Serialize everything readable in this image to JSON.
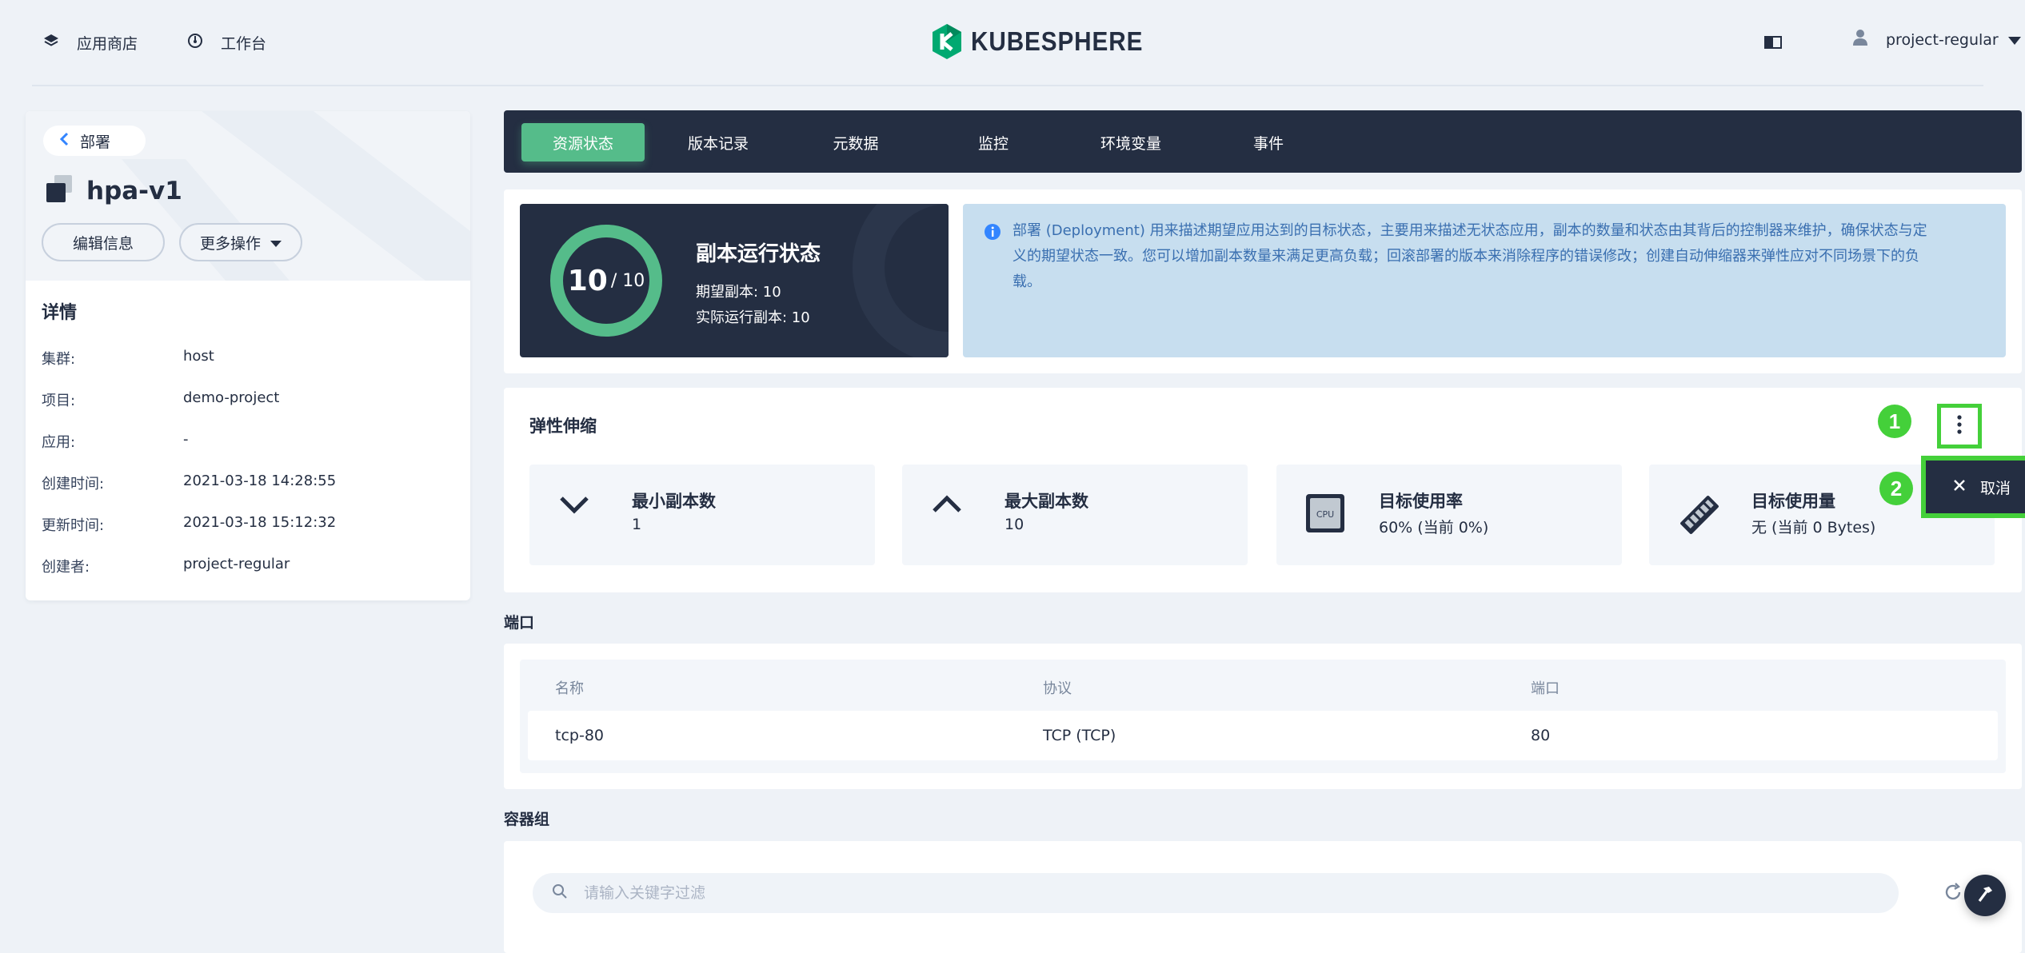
{
  "nav": {
    "app_store": "应用商店",
    "workbench": "工作台",
    "logo_text": "KUBESPHERE",
    "username": "project-regular"
  },
  "sidebar": {
    "back_label": "部署",
    "title": "hpa-v1",
    "edit_button": "编辑信息",
    "more_button": "更多操作",
    "details_title": "详情",
    "details": [
      {
        "key": "集群:",
        "value": "host"
      },
      {
        "key": "项目:",
        "value": "demo-project"
      },
      {
        "key": "应用:",
        "value": "-"
      },
      {
        "key": "创建时间:",
        "value": "2021-03-18 14:28:55"
      },
      {
        "key": "更新时间:",
        "value": "2021-03-18 15:12:32"
      },
      {
        "key": "创建者:",
        "value": "project-regular"
      }
    ]
  },
  "tabs": [
    "资源状态",
    "版本记录",
    "元数据",
    "监控",
    "环境变量",
    "事件"
  ],
  "status": {
    "ring_value": "10",
    "ring_total": "/ 10",
    "title": "副本运行状态",
    "desired": "期望副本: 10",
    "running": "实际运行副本: 10",
    "info_line1": "部署 (Deployment) 用来描述期望应用达到的目标状态，主要用来描述无状态应用，副本的数量和状态由其背后的控制器来维护，确保状态与定",
    "info_line2": "义的期望状态一致。您可以增加副本数量来满足更高负载；回滚部署的版本来消除程序的错误修改；创建自动伸缩器来弹性应对不同场景下的负",
    "info_line3": "载。"
  },
  "hpa": {
    "title": "弹性伸缩",
    "min_title": "最小副本数",
    "min_value": "1",
    "max_title": "最大副本数",
    "max_value": "10",
    "cpu_title": "目标使用率",
    "cpu_value": "60% (当前 0%)",
    "cpu_icon_label": "CPU",
    "mem_title": "目标使用量",
    "mem_value": "无 (当前 0 Bytes)",
    "badge1": "1",
    "badge2": "2",
    "cancel_label": "取消"
  },
  "ports": {
    "section_title": "端口",
    "headers": [
      "名称",
      "协议",
      "端口"
    ],
    "row": [
      "tcp-80",
      "TCP (TCP)",
      "80"
    ]
  },
  "containers": {
    "section_title": "容器组",
    "search_placeholder": "请输入关键字过滤"
  },
  "colors": {
    "accent_green": "#55bc8a",
    "dark": "#242e42",
    "highlight": "#44d03a",
    "info_bg": "#c7deef"
  }
}
